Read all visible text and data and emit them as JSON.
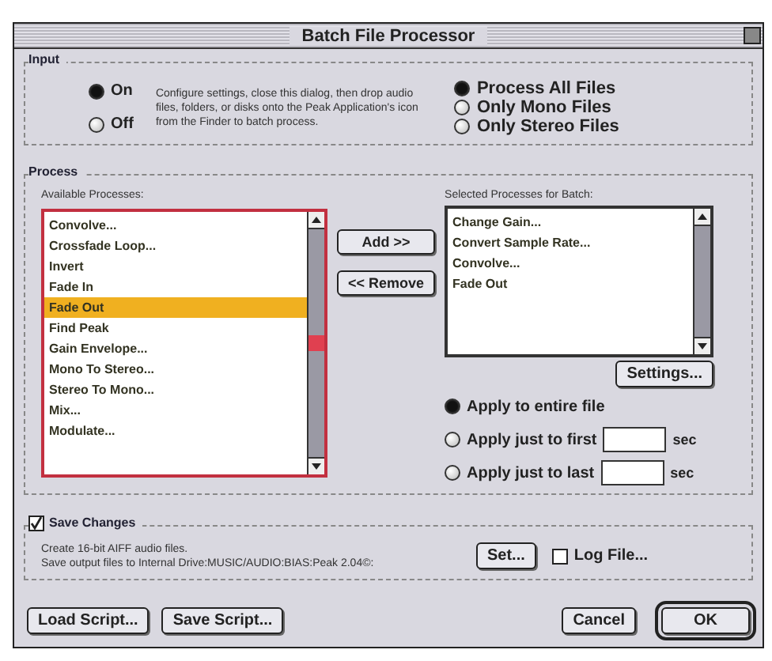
{
  "window": {
    "title": "Batch File Processor"
  },
  "input": {
    "title": "Input",
    "power": [
      {
        "label": "On",
        "selected": true
      },
      {
        "label": "Off",
        "selected": false
      }
    ],
    "description": "Configure settings, close this dialog, then drop audio files, folders, or disks onto the Peak Application's icon from the Finder to batch process.",
    "file_filter": [
      {
        "label": "Process All Files",
        "selected": true
      },
      {
        "label": "Only Mono Files",
        "selected": false
      },
      {
        "label": "Only Stereo Files",
        "selected": false
      }
    ]
  },
  "process": {
    "title": "Process",
    "available_label": "Available Processes:",
    "available": [
      {
        "label": "Convolve...",
        "selected": false
      },
      {
        "label": "Crossfade Loop...",
        "selected": false
      },
      {
        "label": "Invert",
        "selected": false
      },
      {
        "label": "Fade In",
        "selected": false
      },
      {
        "label": "Fade Out",
        "selected": true
      },
      {
        "label": "Find Peak",
        "selected": false
      },
      {
        "label": "Gain Envelope...",
        "selected": false
      },
      {
        "label": "Mono To Stereo...",
        "selected": false
      },
      {
        "label": "Stereo To Mono...",
        "selected": false
      },
      {
        "label": "Mix...",
        "selected": false
      },
      {
        "label": "Modulate...",
        "selected": false
      }
    ],
    "add_button": "Add >>",
    "remove_button": "<< Remove",
    "selected_label": "Selected Processes for Batch:",
    "selected": [
      "Change Gain...",
      "Convert Sample Rate...",
      "Convolve...",
      "Fade Out"
    ],
    "settings_button": "Settings...",
    "apply": [
      {
        "label": "Apply to entire file",
        "selected": true
      },
      {
        "label": "Apply just to first",
        "selected": false,
        "unit": "sec"
      },
      {
        "label": "Apply just to last",
        "selected": false,
        "unit": "sec"
      }
    ]
  },
  "save": {
    "title": "Save Changes",
    "checked": true,
    "lines": [
      "Create 16-bit AIFF audio files.",
      "Save output files to Internal Drive:MUSIC/AUDIO:BIAS:Peak 2.04©:"
    ],
    "set_button": "Set...",
    "log_file": {
      "label": "Log File...",
      "checked": false
    }
  },
  "buttons": [
    {
      "label": "Load Script...",
      "kind": "left"
    },
    {
      "label": "Save Script...",
      "kind": "left"
    },
    {
      "label": "Cancel",
      "kind": "right"
    },
    {
      "label": "OK",
      "kind": "default"
    }
  ]
}
